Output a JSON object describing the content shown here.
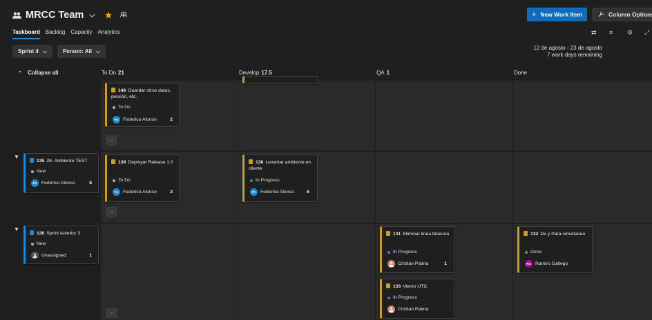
{
  "header": {
    "team_name": "MRCC Team",
    "new_work_item": "New Work Item",
    "column_options": "Column Options",
    "tabs": [
      "Taskboard",
      "Backlog",
      "Capacity",
      "Analytics"
    ],
    "active_tab": "Taskboard"
  },
  "filters": {
    "sprint": "Sprint 4",
    "person": "Person: All"
  },
  "sprint_info": {
    "dates": "12 de agosto - 23 de agosto",
    "remaining": "7 work days remaining"
  },
  "board": {
    "collapse_all": "Collapse all",
    "columns": [
      {
        "name": "To Do",
        "count": "21"
      },
      {
        "name": "Develop",
        "count": "17.5"
      },
      {
        "name": "QA",
        "count": "1"
      },
      {
        "name": "Done",
        "count": ""
      }
    ]
  },
  "rows": [
    {
      "parent": null,
      "cards": [
        {
          "id": "146",
          "title": "Guardar otros datos, presión, etc.",
          "state": "To Do",
          "assignee": "Federico Alonso",
          "initials": "FA",
          "remaining": "2"
        }
      ]
    },
    {
      "parent": {
        "id": "135",
        "title": "28- Ambiente TEST",
        "state": "New",
        "assignee": "Federico Alonso",
        "initials": "FA",
        "remaining": "8"
      },
      "cards": [
        {
          "id": "139",
          "title": "Deployar Release 1.0",
          "state": "To Do",
          "assignee": "Federico Alonso",
          "initials": "FA",
          "remaining": "2"
        },
        {
          "id": "138",
          "title": "Levantar ambiente en cliente",
          "state": "In Progress",
          "assignee": "Federico Alonso",
          "initials": "FA",
          "remaining": "6"
        }
      ]
    },
    {
      "parent": {
        "id": "130",
        "title": "Sprint Anterior 3",
        "state": "New",
        "assignee": "Unassigned",
        "remaining": "1"
      },
      "cards": [
        {
          "id": "131",
          "title": "Eliminar linea bitacora",
          "state": "In Progress",
          "assignee": "Cristian Palma",
          "remaining": "1"
        },
        {
          "id": "132",
          "title": "De y Para simultaneo",
          "state": "Done",
          "assignee": "Ramiro Gallego",
          "initials": "RG"
        },
        {
          "id": "133",
          "title": "Viento UTC",
          "state": "In Progress",
          "assignee": "Cristian Palma"
        }
      ]
    }
  ],
  "colors": {
    "accent": "#0f6cbd",
    "task_bar": "#c9a021",
    "pbi_bar": "#1b8ad8",
    "todo": "#b0b0b0",
    "in_progress": "#2b88d8",
    "done": "#3fae49"
  },
  "icons": [
    "people-icon",
    "star-icon",
    "plus-icon",
    "wrench-icon",
    "settings-sliders-icon",
    "filter-icon",
    "gear-icon",
    "fullscreen-icon",
    "chevron-down-icon",
    "collapse-icon",
    "triangle-down-icon"
  ]
}
